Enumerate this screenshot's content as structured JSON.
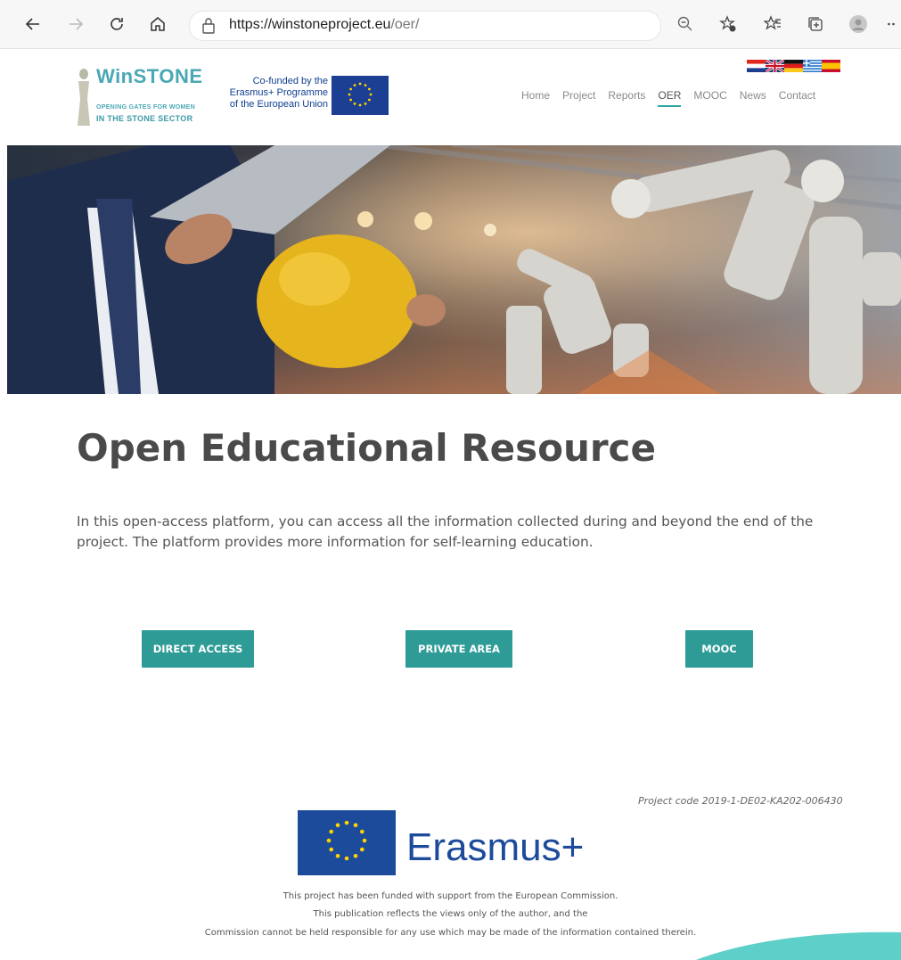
{
  "browser": {
    "url_host": "https://winstoneproject.eu",
    "url_path": "/oer/"
  },
  "header": {
    "logo": {
      "brand": "WinSTONE",
      "tagline_top": "OPENING GATES FOR WOMEN",
      "tagline_bottom": "IN THE STONE SECTOR"
    },
    "cofund": {
      "line1": "Co-funded by the",
      "line2": "Erasmus+ Programme",
      "line3": "of the European Union"
    },
    "menu": [
      "Home",
      "Project",
      "Reports",
      "OER",
      "MOOC",
      "News",
      "Contact"
    ],
    "active_menu": "OER"
  },
  "main": {
    "title": "Open Educational Resource",
    "intro": "In this open-access platform, you can access all the information collected during and beyond the end of the project. The platform provides more information for self-learning education.",
    "buttons": [
      "DIRECT ACCESS",
      "PRIVATE AREA",
      "MOOC"
    ]
  },
  "footer": {
    "project_code": "Project code 2019-1-DE02-KA202-006430",
    "erasmus_word": "Erasmus+",
    "lines": [
      "This project has been funded with support from the European Commission.",
      "This publication reflects the views only of the author, and the",
      "Commission cannot be held responsible for any use which may be made of the information contained therein."
    ]
  },
  "colors": {
    "accent": "#2e9b96",
    "eu_blue": "#1d4b9b",
    "brand_teal": "#4aa8b4"
  }
}
